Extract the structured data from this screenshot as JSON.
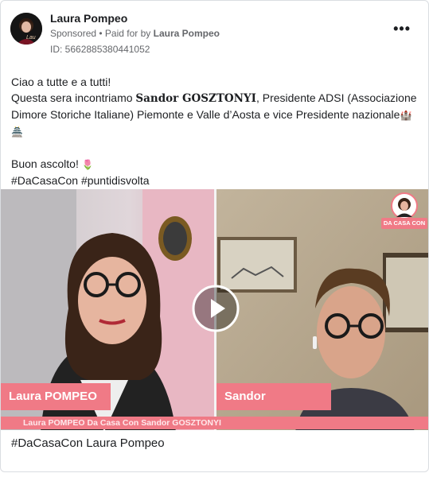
{
  "header": {
    "page_name": "Laura Pompeo",
    "sponsored": "Sponsored",
    "paid_for_prefix": " • Paid for by ",
    "paid_for_name": "Laura Pompeo",
    "ad_id": "ID: 5662885380441052",
    "more_label": "•••",
    "avatar_text": "Lau"
  },
  "post": {
    "line1": "Ciao a tutte e a tutti!",
    "line2_a": "Questa sera incontriamo ",
    "line2_name": "Sandor GOSZTONYI",
    "line2_b": ", Presidente ADSI (Associazione Dimore Storiche Italiane) Piemonte e Valle d’Aosta e vice Presidente nazionale",
    "castle_icon": "🏰",
    "pagoda_icon": "🏯",
    "line4": "Buon ascolto! ",
    "tulip_icon": "🌷",
    "hashtags": "#DaCasaCon #puntidisvolta"
  },
  "video": {
    "left_name": "Laura POMPEO",
    "right_name": "Sandor Gosztonyi",
    "bottom_title": "Laura POMPEO Da Casa Con Sandor GOSZTONYI",
    "logo_label": "DA CASA CON"
  },
  "caption": "#DaCasaCon Laura Pompeo",
  "colors": {
    "accent_pink": "#f07a86",
    "text_dark": "#1c1e21",
    "text_gray": "#65676b"
  }
}
